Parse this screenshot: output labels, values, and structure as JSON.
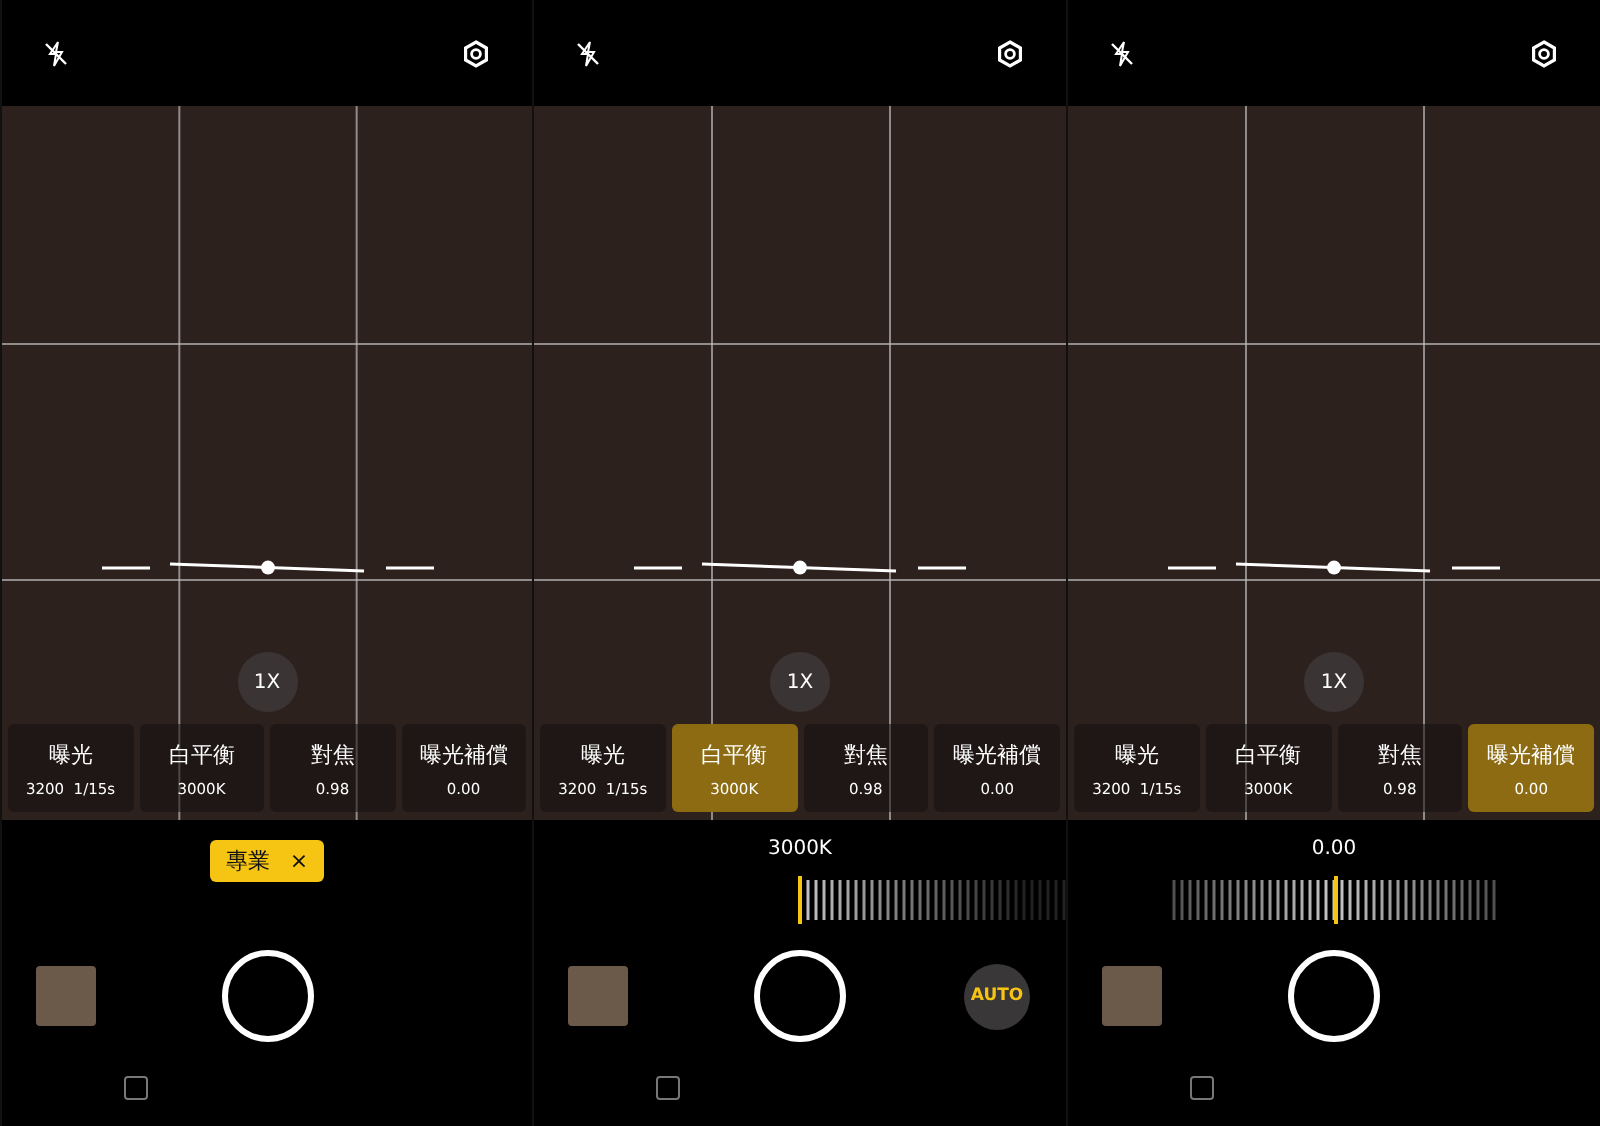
{
  "screens": [
    {
      "tiles": [
        {
          "label": "曝光",
          "value": "3200  1/15s",
          "selected": false
        },
        {
          "label": "白平衡",
          "value": "3000K",
          "selected": false
        },
        {
          "label": "對焦",
          "value": "0.98",
          "selected": false
        },
        {
          "label": "曝光補償",
          "value": "0.00",
          "selected": false
        }
      ],
      "zoom": "1X",
      "control": {
        "kind": "mode_badge",
        "label": "專業",
        "close": "×"
      }
    },
    {
      "tiles": [
        {
          "label": "曝光",
          "value": "3200  1/15s",
          "selected": false
        },
        {
          "label": "白平衡",
          "value": "3000K",
          "selected": true
        },
        {
          "label": "對焦",
          "value": "0.98",
          "selected": false
        },
        {
          "label": "曝光補償",
          "value": "0.00",
          "selected": false
        }
      ],
      "zoom": "1X",
      "control": {
        "kind": "slider",
        "reading": "3000K",
        "level": 0
      },
      "auto_button": "AUTO"
    },
    {
      "tiles": [
        {
          "label": "曝光",
          "value": "3200  1/15s",
          "selected": false
        },
        {
          "label": "白平衡",
          "value": "3000K",
          "selected": false
        },
        {
          "label": "對焦",
          "value": "0.98",
          "selected": false
        },
        {
          "label": "曝光補償",
          "value": "0.00",
          "selected": true
        }
      ],
      "zoom": "1X",
      "control": {
        "kind": "slider",
        "reading": "0.00",
        "level": 0.5
      }
    }
  ]
}
